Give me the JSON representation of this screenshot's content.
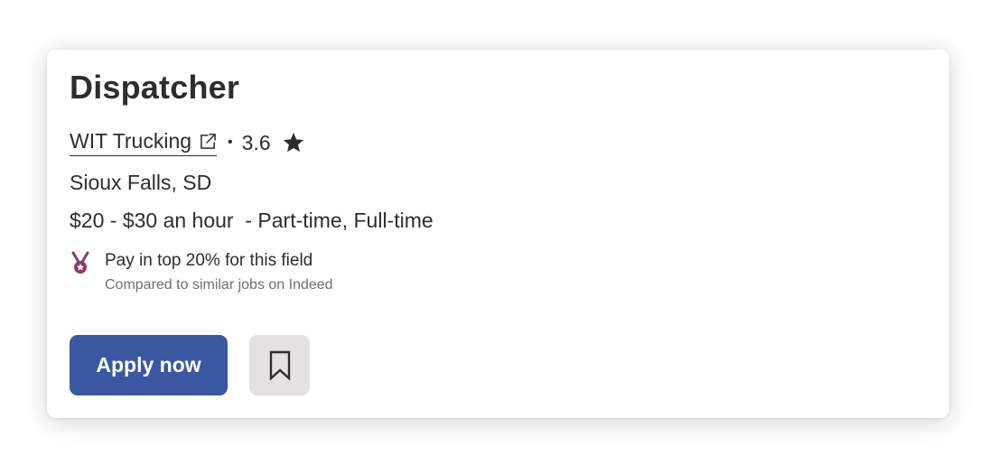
{
  "job": {
    "title": "Dispatcher",
    "company": "WIT Trucking",
    "separator": "•",
    "rating": "3.6",
    "location": "Sioux Falls, SD",
    "salary_line": "$20 - $30 an hour  - Part-time, Full-time"
  },
  "insight": {
    "headline": "Pay in top 20% for this field",
    "subtext": "Compared to similar jobs on Indeed"
  },
  "actions": {
    "apply_label": "Apply now",
    "save_icon": "bookmark-icon"
  },
  "icons": {
    "company_link": "external-link-icon",
    "rating": "star-icon",
    "insight": "medal-icon"
  },
  "colors": {
    "primary": "#3958a1",
    "text": "#2d2d2d",
    "muted_text": "#6f6f6f",
    "medal": "#8b3a6e",
    "secondary_button": "#e4e2e0"
  }
}
